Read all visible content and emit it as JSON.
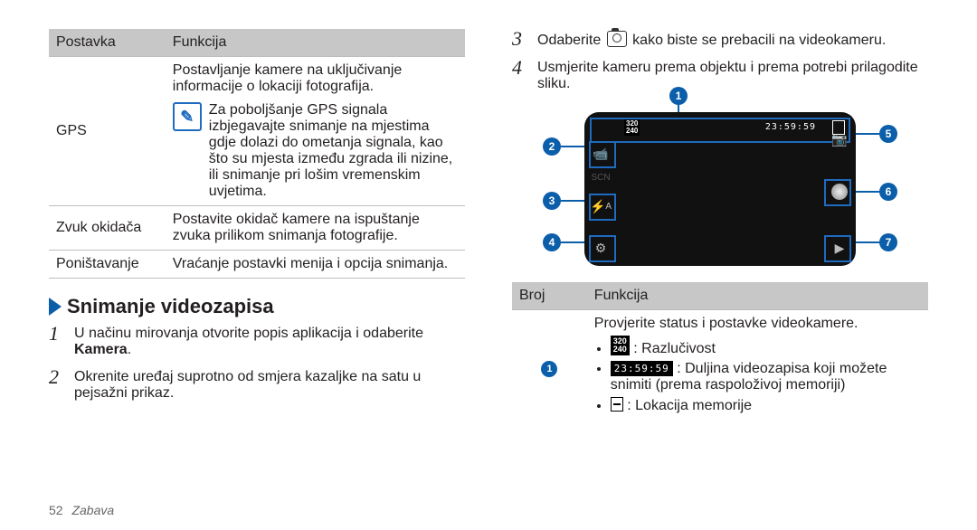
{
  "tableA": {
    "headers": [
      "Postavka",
      "Funkcija"
    ],
    "rows": [
      {
        "setting": "GPS",
        "desc": "Postavljanje kamere na uključivanje informacije o lokaciji fotografija.",
        "note": "Za poboljšanje GPS signala izbjegavajte snimanje na mjestima gdje dolazi do ometanja signala, kao što su mjesta između zgrada ili nizine, ili snimanje pri lošim vremenskim uvjetima."
      },
      {
        "setting": "Zvuk okidača",
        "desc": "Postavite okidač kamere na ispuštanje zvuka prilikom snimanja fotografije."
      },
      {
        "setting": "Poništavanje",
        "desc": "Vraćanje postavki menija i opcija snimanja."
      }
    ]
  },
  "heading": "Snimanje videozapisa",
  "steps12": [
    {
      "n": "1",
      "pre": "U načinu mirovanja otvorite popis aplikacija i odaberite ",
      "bold": "Kamera",
      "post": "."
    },
    {
      "n": "2",
      "pre": "Okrenite uređaj suprotno od smjera kazaljke na satu u pejsažni prikaz."
    }
  ],
  "steps34": [
    {
      "n": "3",
      "pre": "Odaberite ",
      "post": " kako biste se prebacili na videokameru."
    },
    {
      "n": "4",
      "pre": "Usmjerite kameru prema objektu i prema potrebi prilagodite sliku."
    }
  ],
  "screen": {
    "res1": "320",
    "res2": "240",
    "time": "23:59:59"
  },
  "tableB": {
    "headers": [
      "Broj",
      "Funkcija"
    ],
    "row1": {
      "intro": "Provjerite status i postavke videokamere.",
      "b1": "Razlučivost",
      "b2a": "Duljina videozapisa koji možete snimiti (prema raspoloživoj memoriji)",
      "b3": "Lokacija memorije"
    }
  },
  "footer": {
    "page": "52",
    "section": "Zabava"
  }
}
